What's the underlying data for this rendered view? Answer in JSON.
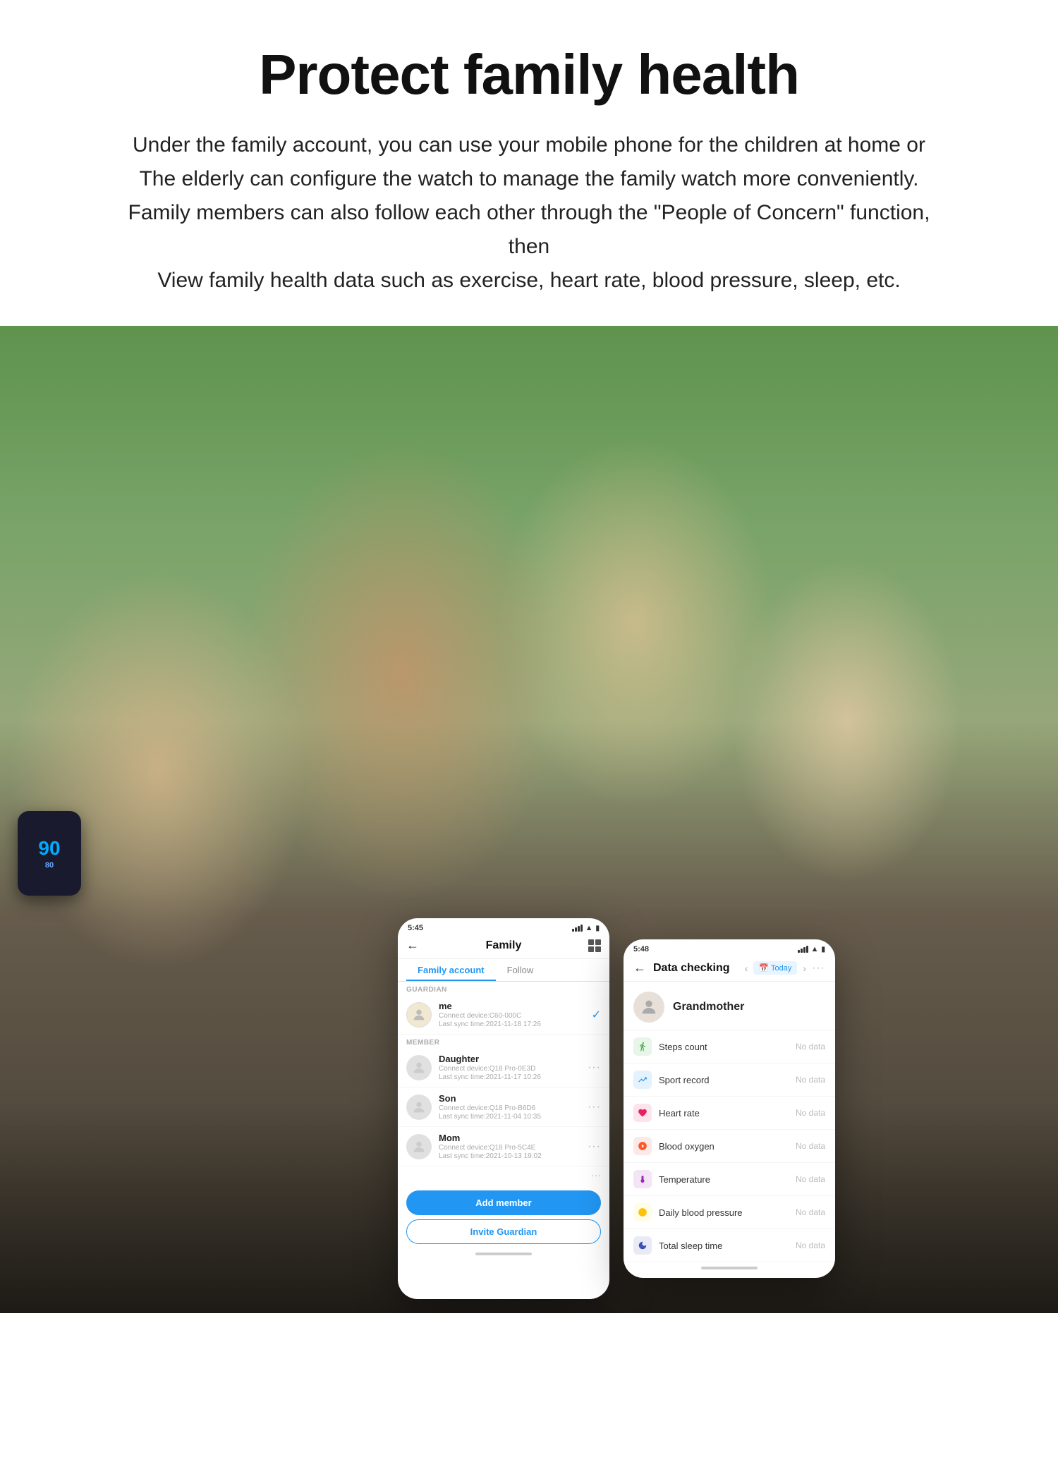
{
  "header": {
    "title": "Protect family health",
    "description": "Under the family account, you can use your mobile phone for the children at home or\nThe elderly can configure the watch to manage the family watch more conveniently.\nFamily members can also follow each other through the \"People of Concern\" function, then\nView family health data such as exercise, heart rate, blood pressure, sleep, etc."
  },
  "phone_left": {
    "status": {
      "time": "5:45",
      "signal": true,
      "wifi": true,
      "battery": true
    },
    "title": "Family",
    "tabs": [
      "Family account",
      "Follow"
    ],
    "sections": {
      "guardian": {
        "label": "GUARDIAN",
        "member": {
          "name": "me",
          "device": "Connect device:C60-000C",
          "sync": "Last sync time:2021-11-18 17:26",
          "checked": true
        }
      },
      "member": {
        "label": "MEMBER",
        "items": [
          {
            "name": "Daughter",
            "device": "Connect device:Q18 Pro-0E3D",
            "sync": "Last sync time:2021-11-17 10:26"
          },
          {
            "name": "Son",
            "device": "Connect device:Q18 Pro-B6D6",
            "sync": "Last sync time:2021-11-04 10:35"
          },
          {
            "name": "Mom",
            "device": "Connect device:Q18 Pro-5C4E",
            "sync": "Last sync time:2021-10-13 19:02"
          }
        ]
      }
    },
    "buttons": {
      "add": "Add member",
      "invite": "Invite Guardian"
    },
    "watch": {
      "steps": "90",
      "unit": "80"
    }
  },
  "phone_right": {
    "status": {
      "time": "5:48",
      "signal": true,
      "wifi": true,
      "battery": true
    },
    "title": "Data checking",
    "date_label": "Today",
    "profile": {
      "name": "Grandmother"
    },
    "metrics": [
      {
        "icon": "👟",
        "name": "Steps count",
        "value": "No data",
        "color": "#4CAF50"
      },
      {
        "icon": "📊",
        "name": "Sport record",
        "value": "No data",
        "color": "#2196F3"
      },
      {
        "icon": "❤️",
        "name": "Heart rate",
        "value": "No data",
        "color": "#e91e63"
      },
      {
        "icon": "🩸",
        "name": "Blood oxygen",
        "value": "No data",
        "color": "#ff5722"
      },
      {
        "icon": "🌡️",
        "name": "Temperature",
        "value": "No data",
        "color": "#9c27b0"
      },
      {
        "icon": "💛",
        "name": "Daily blood pressure",
        "value": "No data",
        "color": "#ffc107"
      },
      {
        "icon": "🌙",
        "name": "Total sleep time",
        "value": "No data",
        "color": "#3f51b5"
      }
    ]
  }
}
